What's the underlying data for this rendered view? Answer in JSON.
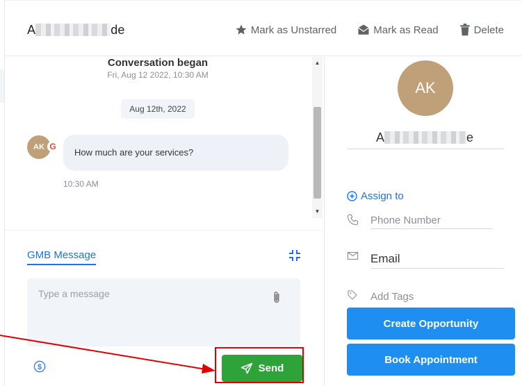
{
  "header": {
    "contact_name_start": "A",
    "contact_name_end": "de",
    "actions": {
      "unstar": "Mark as Unstarred",
      "read": "Mark as Read",
      "delete": "Delete"
    }
  },
  "chat": {
    "conversation_title": "Conversation began",
    "conversation_date": "Fri, Aug 12 2022, 10:30 AM",
    "date_pill": "Aug 12th, 2022",
    "message": {
      "avatar_initials": "AK",
      "channel_badge": "G",
      "text": "How much are your services?",
      "time": "10:30 AM"
    }
  },
  "composer": {
    "tab_label": "GMB Message",
    "placeholder": "Type a message",
    "send_label": "Send"
  },
  "contact_panel": {
    "avatar_initials": "AK",
    "name_start": "A",
    "name_end": "e",
    "assign_label": "Assign to",
    "phone_placeholder": "Phone Number",
    "email_placeholder": "Email",
    "tags_placeholder": "Add Tags",
    "create_opportunity_label": "Create Opportunity",
    "book_appointment_label": "Book Appointment"
  },
  "colors": {
    "accent_blue": "#1a73e8",
    "button_blue": "#1f8ef1",
    "send_green": "#2ea339",
    "avatar_tan": "#bfa079",
    "annotation_red": "#e00000"
  }
}
